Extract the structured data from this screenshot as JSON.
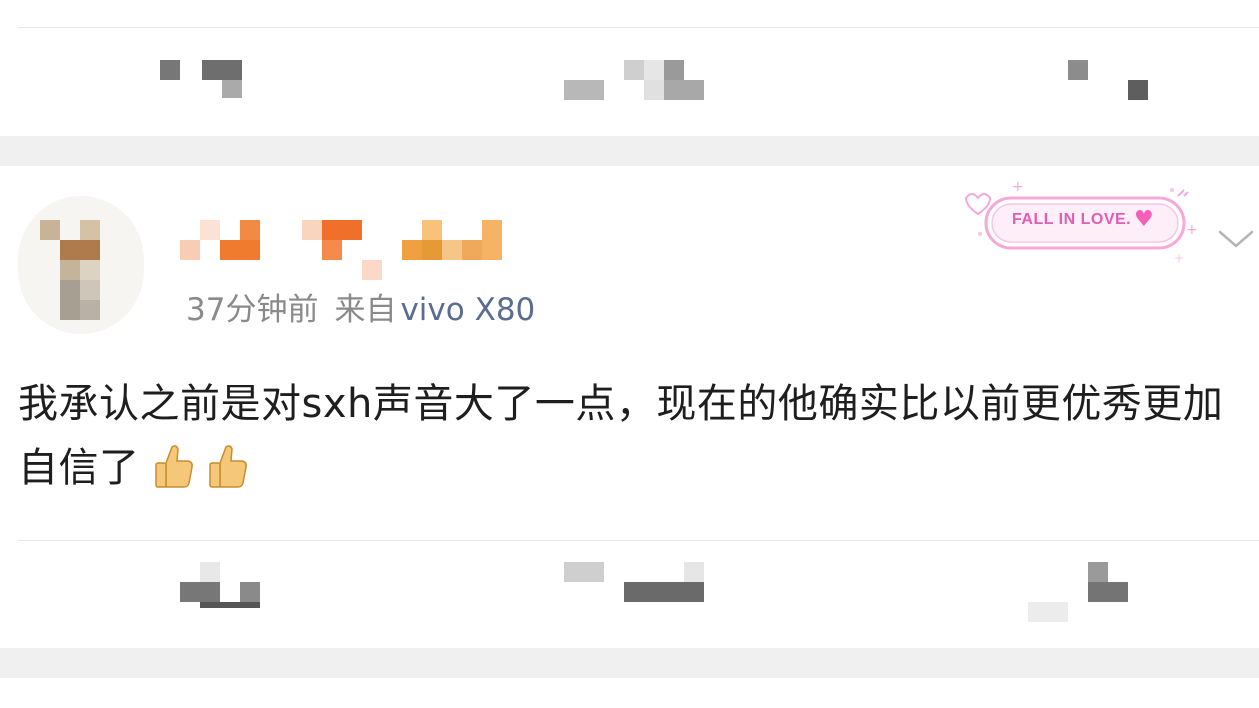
{
  "post": {
    "timestamp": "37分钟前",
    "source_prefix": "来自",
    "device": "vivo X80",
    "text": "我承认之前是对sxh声音大了一点，现在的他确实比以前更优秀更加自信了",
    "emoji": [
      "thumbs-up",
      "thumbs-up"
    ]
  },
  "badge": {
    "label": "FALL IN LOVE."
  },
  "colors": {
    "separator": "#f0f0f0",
    "meta_gray": "#8a8a8a",
    "device_blue": "#5b6d8f",
    "badge_pink": "#f7a8d8",
    "badge_text": "#e05fb5"
  },
  "icons": {
    "more": "chevron-down-icon",
    "badge_heart": "heart-icon"
  }
}
